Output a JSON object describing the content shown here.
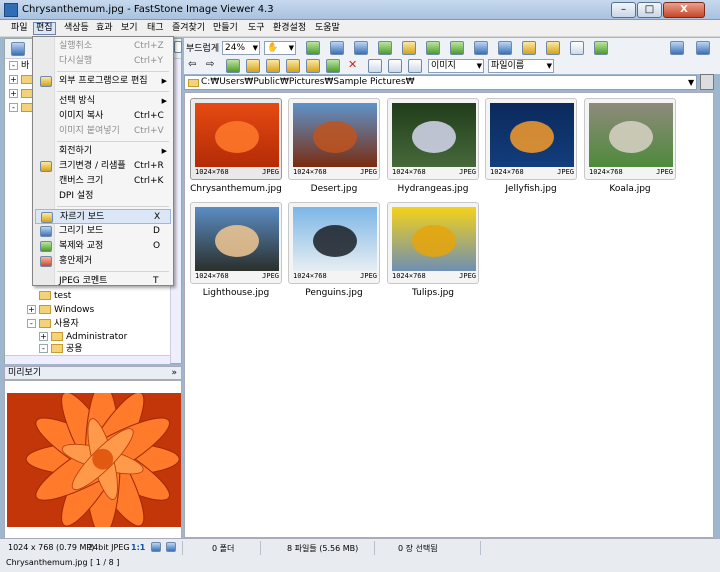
{
  "window": {
    "title": "Chrysanthemum.jpg  -  FastStone Image Viewer 4.3",
    "minimize": "–",
    "maximize": "□",
    "close": "X"
  },
  "menubar": [
    "파일",
    "편집",
    "색상등",
    "효과",
    "보기",
    "태그",
    "즐겨찾기",
    "만들기",
    "도구",
    "환경설정",
    "도움말"
  ],
  "toolbar": {
    "fit_label": "부드럽게",
    "zoom_value": "24%",
    "view_mode": "이미지",
    "sort_mode": "파일이름"
  },
  "path": "C:₩Users₩Public₩Pictures₩Sample Pictures₩",
  "tree": {
    "partial_top": "바",
    "items": [
      "test",
      "Windows",
      "사용자",
      "Administrator",
      "공용"
    ]
  },
  "preview": {
    "header": "미리보기",
    "toggle": "»"
  },
  "edit_menu": [
    {
      "label": "실행취소",
      "shortcut": "Ctrl+Z",
      "disabled": true
    },
    {
      "label": "다시실행",
      "shortcut": "Ctrl+Y",
      "disabled": true
    },
    {
      "sep": true
    },
    {
      "label": "외부 프로그램으로 편집",
      "submenu": true,
      "icon": "edit-external-icon"
    },
    {
      "sep": true
    },
    {
      "label": "선택 방식",
      "submenu": true
    },
    {
      "label": "이미지 복사",
      "shortcut": "Ctrl+C"
    },
    {
      "label": "이미지 붙여넣기",
      "shortcut": "Ctrl+V",
      "disabled": true
    },
    {
      "sep": true
    },
    {
      "label": "회전하기",
      "submenu": true
    },
    {
      "label": "크기변경 / 리샘플",
      "shortcut": "Ctrl+R",
      "icon": "resize-icon"
    },
    {
      "label": "캔버스 크기",
      "shortcut": "Ctrl+K"
    },
    {
      "label": "DPI 설정"
    },
    {
      "sep": true
    },
    {
      "label": "자르기 보드",
      "shortcut": "X",
      "icon": "crop-icon",
      "highlight": true
    },
    {
      "label": "그리기 보드",
      "shortcut": "D",
      "icon": "draw-icon"
    },
    {
      "label": "복제와 교정",
      "shortcut": "O",
      "icon": "clone-icon"
    },
    {
      "label": "홍안제거",
      "icon": "redeye-icon"
    },
    {
      "sep": true
    },
    {
      "label": "JPEG 코멘트",
      "shortcut": "T"
    }
  ],
  "thumbnails": [
    {
      "name": "Chrysanthemum.jpg",
      "dims": "1024×768",
      "type": "JPEG",
      "selected": true,
      "colors": [
        "#e64a12",
        "#ff7a2a",
        "#b32b06"
      ]
    },
    {
      "name": "Desert.jpg",
      "dims": "1024×768",
      "type": "JPEG",
      "colors": [
        "#5f93c9",
        "#c0531f",
        "#7a2c10"
      ]
    },
    {
      "name": "Hydrangeas.jpg",
      "dims": "1024×768",
      "type": "JPEG",
      "colors": [
        "#1f3d1a",
        "#d6d7ef",
        "#47693a"
      ]
    },
    {
      "name": "Jellyfish.jpg",
      "dims": "1024×768",
      "type": "JPEG",
      "colors": [
        "#0b2a5c",
        "#f49b2a",
        "#123d7c"
      ]
    },
    {
      "name": "Koala.jpg",
      "dims": "1024×768",
      "type": "JPEG",
      "colors": [
        "#8f8a7b",
        "#d8d2c6",
        "#4f8a3c"
      ]
    },
    {
      "name": "Lighthouse.jpg",
      "dims": "1024×768",
      "type": "JPEG",
      "colors": [
        "#5b8dc4",
        "#f1c792",
        "#2a2f2a"
      ]
    },
    {
      "name": "Penguins.jpg",
      "dims": "1024×768",
      "type": "JPEG",
      "colors": [
        "#7bb6e6",
        "#1a1f26",
        "#e8eef3"
      ]
    },
    {
      "name": "Tulips.jpg",
      "dims": "1024×768",
      "type": "JPEG",
      "colors": [
        "#f3d21a",
        "#e6a40a",
        "#6f8fb3"
      ]
    }
  ],
  "status": {
    "image_info": "1024 x 768 (0.79 MP)",
    "bit_info": "24bit JPEG",
    "ratio": "1:1",
    "folders": "0 폴더",
    "files": "8 파일들 (5.56 MB)",
    "selected": "0 장 선택됨",
    "current": "Chrysanthemum.jpg [ 1 / 8 ]"
  }
}
